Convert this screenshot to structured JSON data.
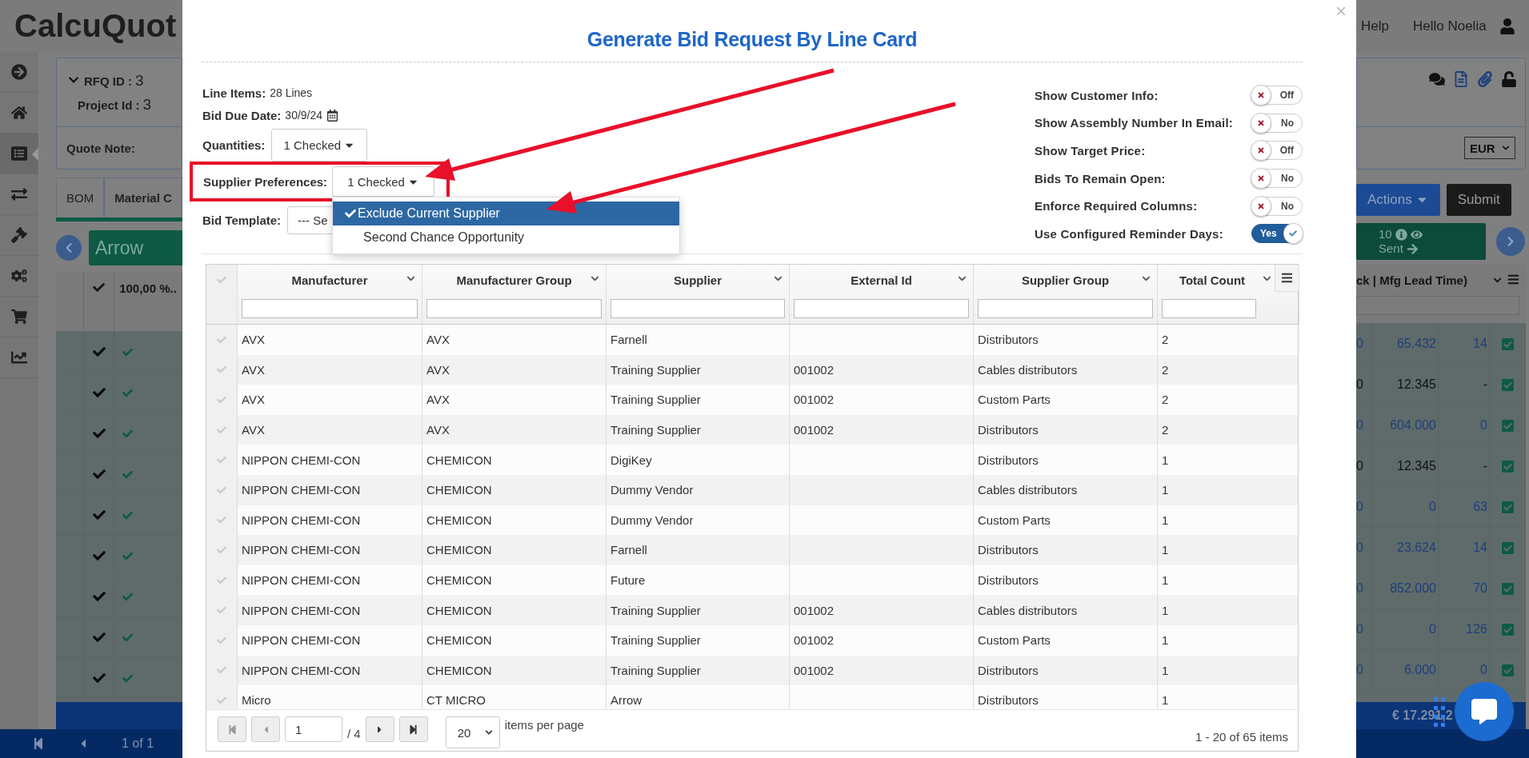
{
  "app": {
    "logo": "CalcuQuot",
    "sidebar": [
      {
        "kind": "forward",
        "selected": false
      },
      {
        "kind": "home",
        "selected": false
      },
      {
        "kind": "list",
        "selected": true
      },
      {
        "kind": "transfer",
        "selected": false
      },
      {
        "kind": "gavel",
        "selected": false
      },
      {
        "kind": "settings",
        "selected": false
      },
      {
        "kind": "cart",
        "selected": false
      },
      {
        "kind": "chart",
        "selected": false
      }
    ],
    "help": "Help",
    "greeting": "Hello Noelia",
    "rfq": {
      "rfq_label": "RFQ ID :",
      "rfq_id": "3",
      "project_label": "Project Id :",
      "project_id": "3",
      "quote_note_label": "Quote Note:",
      "currency": "EUR"
    },
    "tabs": [
      {
        "label": "BOM",
        "selected": false
      },
      {
        "label": "Material C",
        "selected": true
      }
    ],
    "actions": "Actions",
    "submit": "Submit",
    "supplier": "Arrow",
    "sent": {
      "count": "10",
      "label": "Sent"
    },
    "grid": {
      "column_3": "100,00 %..",
      "column_last": "ck | Mfg Lead Time)",
      "rows": [
        {
          "checked": true,
          "approved": true,
          "included": true,
          "kind": "link",
          "column_a": "0",
          "column_b": "65.432",
          "column_c": "14"
        },
        {
          "checked": true,
          "approved": true,
          "included": true,
          "kind": "plain",
          "column_a": "0",
          "column_b": "12.345",
          "column_c": "-"
        },
        {
          "checked": true,
          "approved": true,
          "included": true,
          "kind": "link",
          "column_a": "0",
          "column_b": "604.000",
          "column_c": "0"
        },
        {
          "checked": true,
          "approved": true,
          "included": true,
          "kind": "plain",
          "column_a": "0",
          "column_b": "12.345",
          "column_c": "-"
        },
        {
          "checked": true,
          "approved": true,
          "included": true,
          "kind": "link",
          "column_a": "0",
          "column_b": "0",
          "column_c": "63"
        },
        {
          "checked": true,
          "approved": true,
          "included": true,
          "kind": "link",
          "column_a": "0",
          "column_b": "23.624",
          "column_c": "14"
        },
        {
          "checked": true,
          "approved": true,
          "included": true,
          "kind": "link",
          "column_a": "0",
          "column_b": "852.000",
          "column_c": "70"
        },
        {
          "checked": true,
          "approved": true,
          "included": true,
          "kind": "link",
          "column_a": "0",
          "column_b": "0",
          "column_c": "126"
        },
        {
          "checked": true,
          "approved": true,
          "included": true,
          "kind": "link",
          "column_a": "0",
          "column_b": "6.000",
          "column_c": "0"
        }
      ]
    },
    "total": "€ 17.291,2",
    "pager": "1 of 1"
  },
  "modal": {
    "close": "×",
    "title": "Generate Bid Request By Line Card",
    "line_items": {
      "label": "Line Items:",
      "value": "28 Lines"
    },
    "bid_due_date": {
      "label": "Bid Due Date:",
      "value": "30/9/24"
    },
    "quantities": {
      "label": "Quantities:",
      "value": "1 Checked"
    },
    "supplier_preferences": {
      "label": "Supplier Preferences:",
      "value": "1 Checked",
      "expanded": true,
      "options": [
        {
          "label": "Exclude Current Supplier",
          "selected": true
        },
        {
          "label": "Second Chance Opportunity",
          "selected": false
        }
      ]
    },
    "bid_template": {
      "label": "Bid Template:",
      "value": "--- Se"
    },
    "toggles": [
      {
        "label": "Show Customer Info:",
        "on": false,
        "text": "Off"
      },
      {
        "label": "Show Assembly Number In Email:",
        "on": false,
        "text": "No"
      },
      {
        "label": "Show Target Price:",
        "on": false,
        "text": "Off"
      },
      {
        "label": "Bids To Remain Open:",
        "on": false,
        "text": "No"
      },
      {
        "label": "Enforce Required Columns:",
        "on": false,
        "text": "No"
      },
      {
        "label": "Use Configured Reminder Days:",
        "on": true,
        "text": "Yes"
      }
    ],
    "table": {
      "columns": [
        "Manufacturer",
        "Manufacturer Group",
        "Supplier",
        "External Id",
        "Supplier Group",
        "Total Count"
      ],
      "rows": [
        {
          "selected": false,
          "cells": [
            "AVX",
            "AVX",
            "Farnell",
            "",
            "Distributors",
            "2"
          ]
        },
        {
          "selected": false,
          "cells": [
            "AVX",
            "AVX",
            "Training Supplier",
            "001002",
            "Cables distributors",
            "2"
          ]
        },
        {
          "selected": false,
          "cells": [
            "AVX",
            "AVX",
            "Training Supplier",
            "001002",
            "Custom Parts",
            "2"
          ]
        },
        {
          "selected": false,
          "cells": [
            "AVX",
            "AVX",
            "Training Supplier",
            "001002",
            "Distributors",
            "2"
          ]
        },
        {
          "selected": false,
          "cells": [
            "NIPPON CHEMI-CON",
            "CHEMICON",
            "DigiKey",
            "",
            "Distributors",
            "1"
          ]
        },
        {
          "selected": false,
          "cells": [
            "NIPPON CHEMI-CON",
            "CHEMICON",
            "Dummy Vendor",
            "",
            "Cables distributors",
            "1"
          ]
        },
        {
          "selected": false,
          "cells": [
            "NIPPON CHEMI-CON",
            "CHEMICON",
            "Dummy Vendor",
            "",
            "Custom Parts",
            "1"
          ]
        },
        {
          "selected": false,
          "cells": [
            "NIPPON CHEMI-CON",
            "CHEMICON",
            "Farnell",
            "",
            "Distributors",
            "1"
          ]
        },
        {
          "selected": false,
          "cells": [
            "NIPPON CHEMI-CON",
            "CHEMICON",
            "Future",
            "",
            "Distributors",
            "1"
          ]
        },
        {
          "selected": false,
          "cells": [
            "NIPPON CHEMI-CON",
            "CHEMICON",
            "Training Supplier",
            "001002",
            "Cables distributors",
            "1"
          ]
        },
        {
          "selected": false,
          "cells": [
            "NIPPON CHEMI-CON",
            "CHEMICON",
            "Training Supplier",
            "001002",
            "Custom Parts",
            "1"
          ]
        },
        {
          "selected": false,
          "cells": [
            "NIPPON CHEMI-CON",
            "CHEMICON",
            "Training Supplier",
            "001002",
            "Distributors",
            "1"
          ]
        },
        {
          "selected": false,
          "cells": [
            "Micro",
            "CT MICRO",
            "Arrow",
            "",
            "Distributors",
            "1"
          ]
        }
      ]
    },
    "pager": {
      "page": "1",
      "of": "/ 4",
      "page_size": "20",
      "page_size_label": "items per page",
      "summary": "1 - 20 of 65 items"
    }
  }
}
